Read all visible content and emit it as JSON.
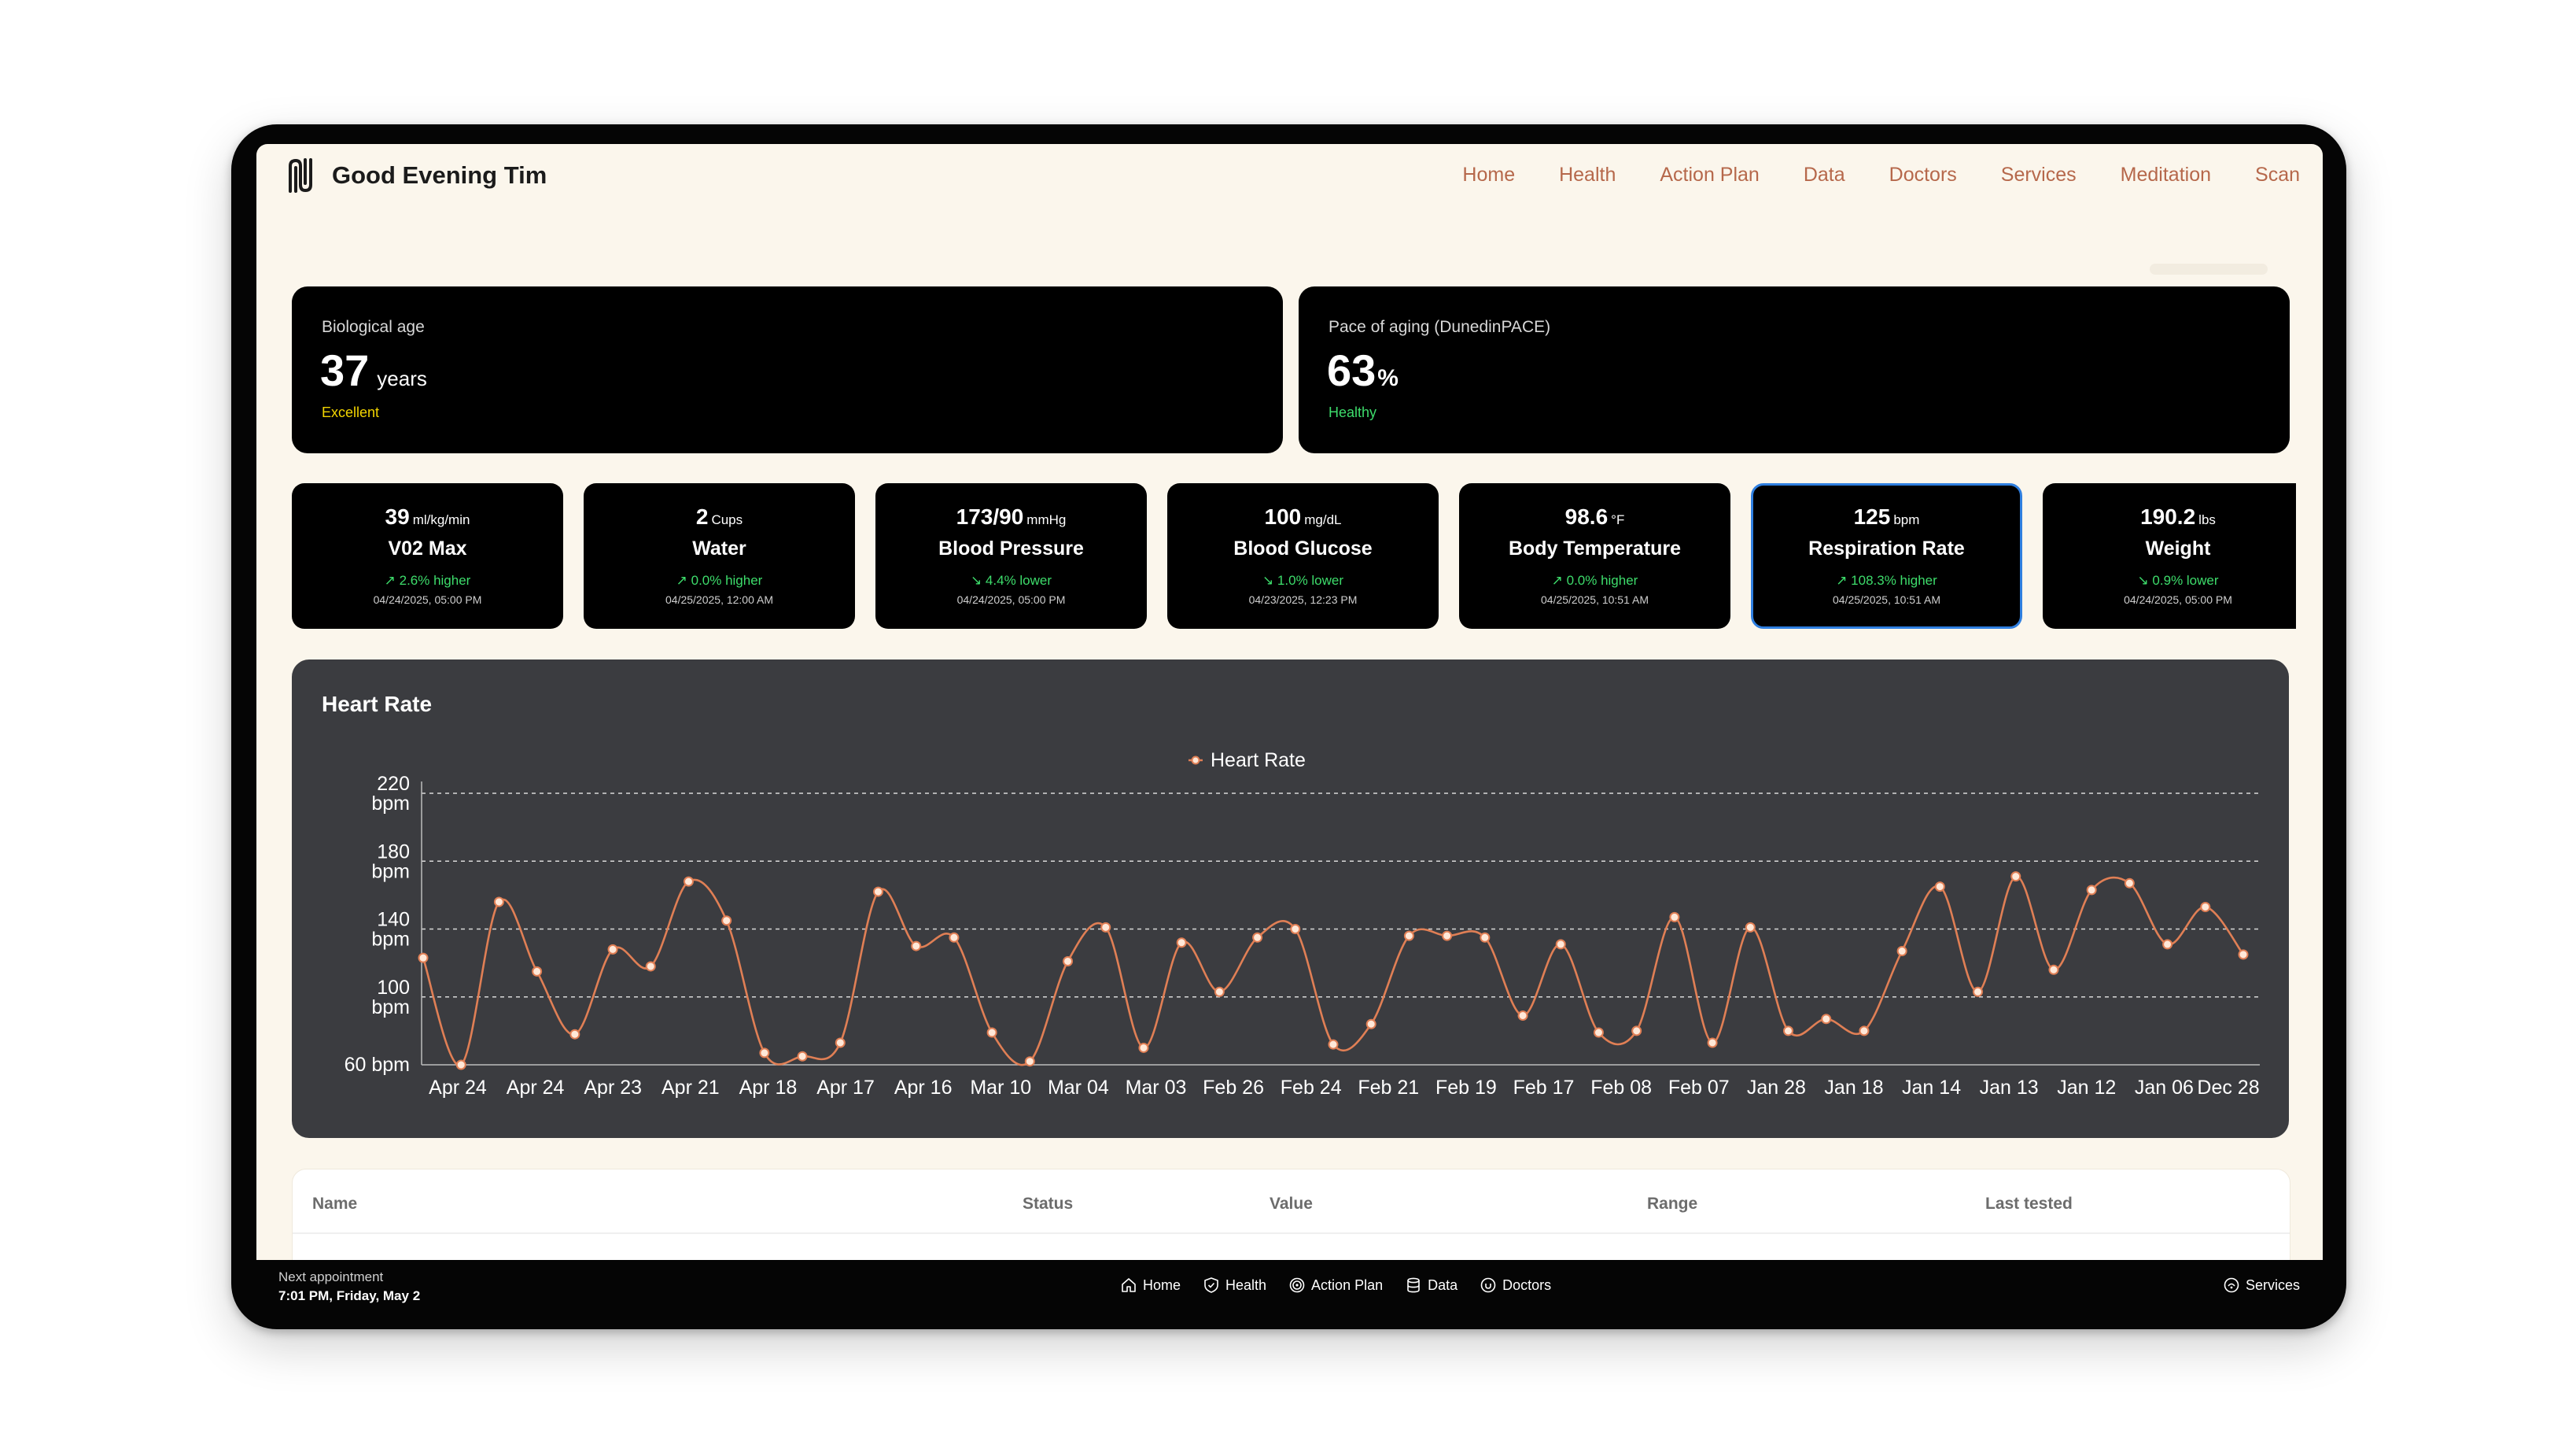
{
  "header": {
    "greeting": "Good Evening Tim",
    "nav": [
      "Home",
      "Health",
      "Action Plan",
      "Data",
      "Doctors",
      "Services",
      "Meditation",
      "Scan"
    ]
  },
  "bio_card": {
    "label": "Biological age",
    "value": "37",
    "unit": "years",
    "status": "Excellent",
    "status_color": "#f2d400"
  },
  "pace_card": {
    "label": "Pace of aging (DunedinPACE)",
    "value": "63",
    "unit": "%",
    "status": "Healthy",
    "status_color": "#3ddc6b"
  },
  "metrics": [
    {
      "value": "39",
      "unit": "ml/kg/min",
      "name": "V02 Max",
      "change": "↗ 2.6% higher",
      "date": "04/24/2025, 05:00 PM"
    },
    {
      "value": "2",
      "unit": "Cups",
      "name": "Water",
      "change": "↗ 0.0% higher",
      "date": "04/25/2025, 12:00 AM"
    },
    {
      "value": "173/90",
      "unit": "mmHg",
      "name": "Blood Pressure",
      "change": "↘ 4.4% lower",
      "date": "04/24/2025, 05:00 PM"
    },
    {
      "value": "100",
      "unit": "mg/dL",
      "name": "Blood Glucose",
      "change": "↘ 1.0% lower",
      "date": "04/23/2025, 12:23 PM"
    },
    {
      "value": "98.6",
      "unit": "°F",
      "name": "Body Temperature",
      "change": "↗ 0.0% higher",
      "date": "04/25/2025, 10:51 AM"
    },
    {
      "value": "125",
      "unit": "bpm",
      "name": "Respiration Rate",
      "change": "↗ 108.3% higher",
      "date": "04/25/2025, 10:51 AM"
    },
    {
      "value": "190.2",
      "unit": "lbs",
      "name": "Weight",
      "change": "↘ 0.9% lower",
      "date": "04/24/2025, 05:00 PM"
    }
  ],
  "chart_panel_title": "Heart Rate",
  "chart_data": {
    "type": "line",
    "title": "",
    "legend": "Heart Rate",
    "legend_position": "top-center",
    "series": [
      {
        "name": "Heart Rate",
        "color": "#e07f55",
        "values": [
          123,
          60,
          156,
          115,
          78,
          128,
          118,
          168,
          145,
          67,
          65,
          73,
          162,
          130,
          135,
          79,
          62,
          121,
          141,
          70,
          132,
          103,
          135,
          140,
          72,
          84,
          136,
          136,
          135,
          89,
          131,
          79,
          80,
          147,
          73,
          141,
          80,
          87,
          80,
          127,
          165,
          103,
          171,
          116,
          163,
          167,
          131,
          153,
          125
        ]
      }
    ],
    "y_ticks": [
      "220 bpm",
      "180 bpm",
      "140 bpm",
      "100 bpm",
      "60 bpm"
    ],
    "y_tick_values": [
      220,
      180,
      140,
      100,
      60
    ],
    "ylim": [
      60,
      220
    ],
    "x_labels": [
      "Apr 24",
      "Apr 24",
      "Apr 23",
      "Apr 21",
      "Apr 18",
      "Apr 17",
      "Apr 16",
      "Mar 10",
      "Mar 04",
      "Mar 03",
      "Feb 26",
      "Feb 24",
      "Feb 21",
      "Feb 19",
      "Feb 17",
      "Feb 08",
      "Feb 07",
      "Jan 28",
      "Jan 18",
      "Jan 14",
      "Jan 13",
      "Jan 12",
      "Jan 06",
      "Dec 28"
    ],
    "grid": true
  },
  "table": {
    "headers": [
      "Name",
      "Status",
      "Value",
      "Range",
      "Last tested"
    ]
  },
  "bottom_bar": {
    "label": "Next appointment",
    "time": "7:01 PM, Friday, May 2",
    "nav": [
      "Home",
      "Health",
      "Action Plan",
      "Data",
      "Doctors"
    ],
    "right": "Services"
  }
}
